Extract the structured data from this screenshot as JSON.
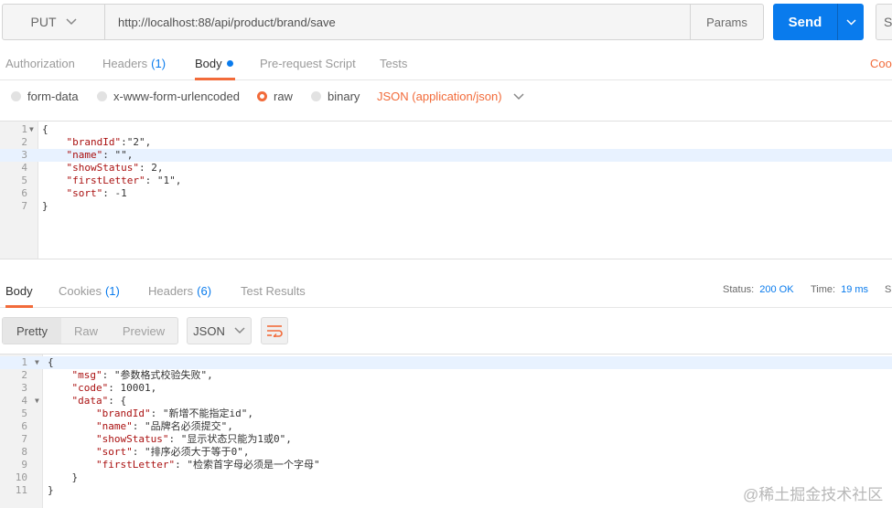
{
  "request": {
    "method": "PUT",
    "url": "http://localhost:88/api/product/brand/save",
    "params_label": "Params",
    "send_label": "Send",
    "save_label": "Sa"
  },
  "request_tabs": [
    {
      "label": "Authorization",
      "count": ""
    },
    {
      "label": "Headers",
      "count": "(1)"
    },
    {
      "label": "Body",
      "count": ""
    },
    {
      "label": "Pre-request Script",
      "count": ""
    },
    {
      "label": "Tests",
      "count": ""
    }
  ],
  "cookies_label": "Coo",
  "body_types": [
    {
      "label": "form-data",
      "selected": false
    },
    {
      "label": "x-www-form-urlencoded",
      "selected": false
    },
    {
      "label": "raw",
      "selected": true
    },
    {
      "label": "binary",
      "selected": false
    }
  ],
  "content_type": "JSON (application/json)",
  "request_body": {
    "line_numbers": [
      "1",
      "2",
      "3",
      "4",
      "5",
      "6",
      "7"
    ],
    "lines": [
      "{",
      "    \"brandId\":\"2\",",
      "    \"name\": \"\",",
      "    \"showStatus\": 2,",
      "    \"firstLetter\": \"1\",",
      "    \"sort\": -1",
      "}"
    ]
  },
  "response_tabs": [
    {
      "label": "Body",
      "count": ""
    },
    {
      "label": "Cookies",
      "count": "(1)"
    },
    {
      "label": "Headers",
      "count": "(6)"
    },
    {
      "label": "Test Results",
      "count": ""
    }
  ],
  "status": {
    "label": "Status:",
    "value": "200 OK"
  },
  "time": {
    "label": "Time:",
    "value": "19 ms"
  },
  "size_label": "S",
  "view_modes": [
    "Pretty",
    "Raw",
    "Preview"
  ],
  "format": "JSON",
  "response_body": {
    "line_numbers": [
      "1",
      "2",
      "3",
      "4",
      "5",
      "6",
      "7",
      "8",
      "9",
      "10",
      "11"
    ],
    "lines": [
      "{",
      "    \"msg\": \"参数格式校验失败\",",
      "    \"code\": 10001,",
      "    \"data\": {",
      "        \"brandId\": \"新增不能指定id\",",
      "        \"name\": \"品牌名必须提交\",",
      "        \"showStatus\": \"显示状态只能为1或0\",",
      "        \"sort\": \"排序必须大于等于0\",",
      "        \"firstLetter\": \"检索首字母必须是一个字母\"",
      "    }",
      "}"
    ]
  },
  "watermark": "@稀土掘金技术社区",
  "colors": {
    "accent": "#f26b3a",
    "primary": "#097bed"
  }
}
